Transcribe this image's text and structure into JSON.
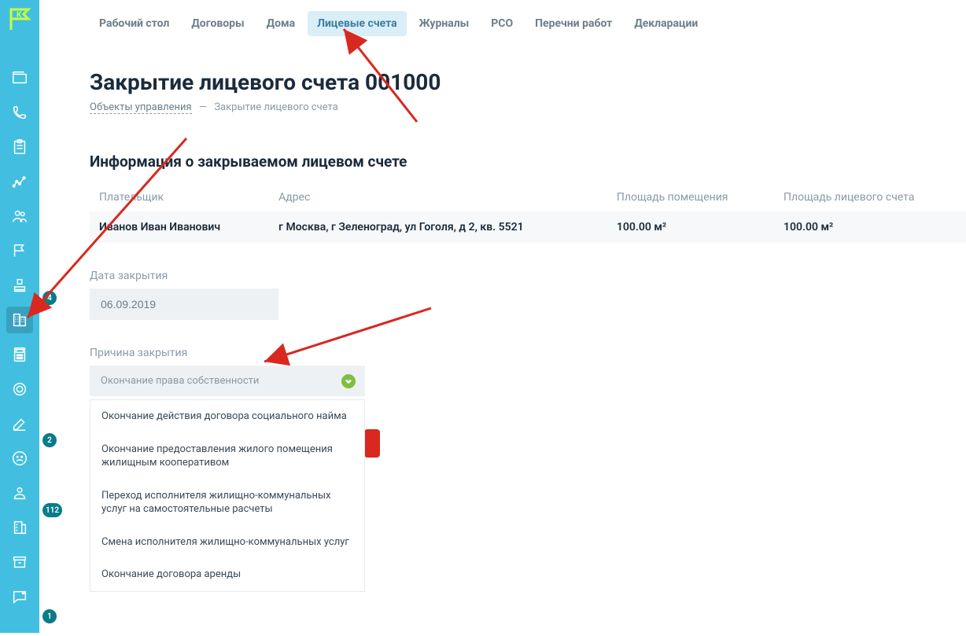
{
  "topnav": [
    {
      "label": "Рабочий стол",
      "active": false
    },
    {
      "label": "Договоры",
      "active": false
    },
    {
      "label": "Дома",
      "active": false
    },
    {
      "label": "Лицевые счета",
      "active": true
    },
    {
      "label": "Журналы",
      "active": false
    },
    {
      "label": "РСО",
      "active": false
    },
    {
      "label": "Перечни работ",
      "active": false
    },
    {
      "label": "Декларации",
      "active": false
    }
  ],
  "page_title": "Закрытие лицевого счета 001000",
  "breadcrumb": {
    "link": "Объекты управления",
    "sep": "—",
    "current": "Закрытие лицевого счета"
  },
  "section_title": "Информация о закрываемом лицевом счете",
  "table": {
    "headers": [
      "Плательщик",
      "Адрес",
      "Площадь помещения",
      "Площадь лицевого счета"
    ],
    "row": [
      "Иванов Иван Иванович",
      "г Москва, г Зеленоград, ул Гоголя, д 2, кв. 5521",
      "100.00 м²",
      "100.00 м²"
    ]
  },
  "form": {
    "date_label": "Дата закрытия",
    "date_value": "06.09.2019",
    "reason_label": "Причина закрытия",
    "reason_selected": "Окончание права собственности",
    "options": [
      "Окончание действия договора социального найма",
      "Окончание предоставления жилого помещения жилищным кооперативом",
      "Переход исполнителя жилищно-коммунальных услуг на самостоятельные расчеты",
      "Смена исполнителя жилищно-коммунальных услуг",
      "Окончание договора аренды"
    ]
  },
  "badges": {
    "b1": "4",
    "b2": "2",
    "b3": "112",
    "b4": "1"
  }
}
